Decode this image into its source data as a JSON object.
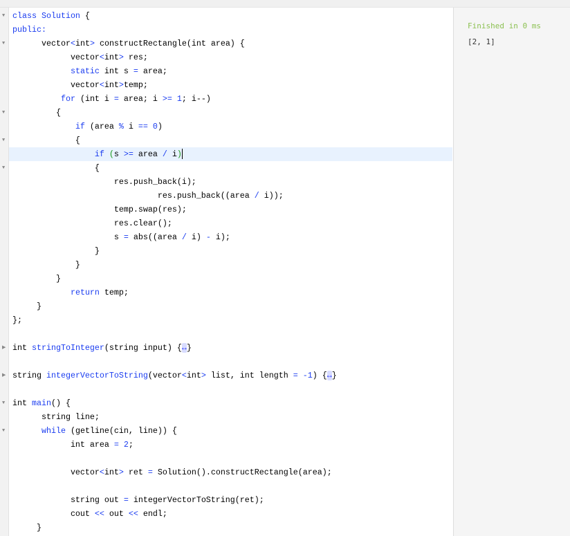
{
  "editor": {
    "lines": [
      {
        "fold": "open",
        "t": [
          [
            "class Solution",
            "k"
          ],
          [
            " {",
            ""
          ]
        ]
      },
      {
        "t": [
          [
            "public:",
            "k"
          ]
        ]
      },
      {
        "fold": "open",
        "t": [
          [
            "      vector",
            ""
          ],
          [
            "<",
            "k"
          ],
          [
            "int",
            ""
          ],
          [
            ">",
            "k"
          ],
          [
            " constructRectangle(int area) {",
            ""
          ]
        ]
      },
      {
        "t": [
          [
            "            vector",
            ""
          ],
          [
            "<",
            "k"
          ],
          [
            "int",
            ""
          ],
          [
            ">",
            "k"
          ],
          [
            " res;",
            ""
          ]
        ]
      },
      {
        "t": [
          [
            "            ",
            ""
          ],
          [
            "static",
            "k"
          ],
          [
            " int s ",
            ""
          ],
          [
            "=",
            "k"
          ],
          [
            " area;",
            ""
          ]
        ]
      },
      {
        "t": [
          [
            "            vector",
            ""
          ],
          [
            "<",
            "k"
          ],
          [
            "int",
            ""
          ],
          [
            ">",
            "k"
          ],
          [
            "temp;",
            ""
          ]
        ]
      },
      {
        "t": [
          [
            "          ",
            ""
          ],
          [
            "for",
            "k"
          ],
          [
            " (int i ",
            ""
          ],
          [
            "=",
            "k"
          ],
          [
            " area; i ",
            ""
          ],
          [
            ">=",
            "k"
          ],
          [
            " ",
            ""
          ],
          [
            "1",
            "k"
          ],
          [
            "; i--)",
            ""
          ]
        ]
      },
      {
        "fold": "open",
        "t": [
          [
            "         {",
            ""
          ]
        ]
      },
      {
        "t": [
          [
            "             ",
            ""
          ],
          [
            "if",
            "k"
          ],
          [
            " (area ",
            ""
          ],
          [
            "%",
            "k"
          ],
          [
            " i ",
            ""
          ],
          [
            "==",
            "k"
          ],
          [
            " ",
            ""
          ],
          [
            "0",
            "k"
          ],
          [
            ")",
            ""
          ]
        ]
      },
      {
        "fold": "open",
        "t": [
          [
            "             {",
            ""
          ]
        ]
      },
      {
        "hl": true,
        "cursor": true,
        "t": [
          [
            "                 ",
            ""
          ],
          [
            "if",
            "k"
          ],
          [
            " ",
            ""
          ],
          [
            "(",
            "g"
          ],
          [
            "s ",
            ""
          ],
          [
            ">=",
            "k"
          ],
          [
            " area ",
            ""
          ],
          [
            "/",
            "k"
          ],
          [
            " i",
            ""
          ],
          [
            ")",
            "g"
          ]
        ]
      },
      {
        "fold": "open",
        "t": [
          [
            "                 {",
            ""
          ]
        ]
      },
      {
        "t": [
          [
            "                     res.push_back(i);",
            ""
          ]
        ]
      },
      {
        "t": [
          [
            "                              res.push_back((area ",
            ""
          ],
          [
            "/",
            "k"
          ],
          [
            " i));",
            ""
          ]
        ]
      },
      {
        "t": [
          [
            "                     temp.swap(res);",
            ""
          ]
        ]
      },
      {
        "t": [
          [
            "                     res.clear();",
            ""
          ]
        ]
      },
      {
        "t": [
          [
            "                     s ",
            ""
          ],
          [
            "=",
            "k"
          ],
          [
            " abs((area ",
            ""
          ],
          [
            "/",
            "k"
          ],
          [
            " i) ",
            ""
          ],
          [
            "-",
            "k"
          ],
          [
            " i);",
            ""
          ]
        ]
      },
      {
        "t": [
          [
            "                 }",
            ""
          ]
        ]
      },
      {
        "t": [
          [
            "             }",
            ""
          ]
        ]
      },
      {
        "t": [
          [
            "         }",
            ""
          ]
        ]
      },
      {
        "t": [
          [
            "            ",
            ""
          ],
          [
            "return",
            "k"
          ],
          [
            " temp;",
            ""
          ]
        ]
      },
      {
        "t": [
          [
            "     }",
            ""
          ]
        ]
      },
      {
        "t": [
          [
            "};",
            ""
          ]
        ]
      },
      {
        "t": []
      },
      {
        "fold": "closed",
        "t": [
          [
            "int ",
            ""
          ],
          [
            "stringToInteger",
            "k"
          ],
          [
            "(string input) {",
            ""
          ],
          [
            "↔",
            "coll"
          ],
          [
            "}",
            ""
          ]
        ]
      },
      {
        "t": []
      },
      {
        "fold": "closed",
        "t": [
          [
            "string ",
            ""
          ],
          [
            "integerVectorToString",
            "k"
          ],
          [
            "(vector",
            ""
          ],
          [
            "<",
            "k"
          ],
          [
            "int",
            ""
          ],
          [
            ">",
            "k"
          ],
          [
            " list, int length ",
            ""
          ],
          [
            "=",
            "k"
          ],
          [
            " ",
            ""
          ],
          [
            "-1",
            "k"
          ],
          [
            ") {",
            ""
          ],
          [
            "↔",
            "coll"
          ],
          [
            "}",
            ""
          ]
        ]
      },
      {
        "t": []
      },
      {
        "fold": "open",
        "t": [
          [
            "int ",
            ""
          ],
          [
            "main",
            "k"
          ],
          [
            "() {",
            ""
          ]
        ]
      },
      {
        "t": [
          [
            "      string line;",
            ""
          ]
        ]
      },
      {
        "fold": "open",
        "t": [
          [
            "      ",
            ""
          ],
          [
            "while",
            "k"
          ],
          [
            " (getline(cin, line)) {",
            ""
          ]
        ]
      },
      {
        "t": [
          [
            "            int area ",
            ""
          ],
          [
            "=",
            "k"
          ],
          [
            " ",
            ""
          ],
          [
            "2",
            "k"
          ],
          [
            ";",
            ""
          ]
        ]
      },
      {
        "t": []
      },
      {
        "t": [
          [
            "            vector",
            ""
          ],
          [
            "<",
            "k"
          ],
          [
            "int",
            ""
          ],
          [
            ">",
            "k"
          ],
          [
            " ret ",
            ""
          ],
          [
            "=",
            "k"
          ],
          [
            " Solution().constructRectangle(area);",
            ""
          ]
        ]
      },
      {
        "t": []
      },
      {
        "t": [
          [
            "            string out ",
            ""
          ],
          [
            "=",
            "k"
          ],
          [
            " integerVectorToString(ret);",
            ""
          ]
        ]
      },
      {
        "t": [
          [
            "            cout ",
            ""
          ],
          [
            "<<",
            "k"
          ],
          [
            " out ",
            ""
          ],
          [
            "<<",
            "k"
          ],
          [
            " endl;",
            ""
          ]
        ]
      },
      {
        "t": [
          [
            "     }",
            ""
          ]
        ]
      }
    ]
  },
  "output": {
    "status": "Finished in 0 ms",
    "result": "[2, 1]"
  },
  "colors": {
    "keyword": "#1a3cf0",
    "status": "#8cc152",
    "highlight": "#e8f2fe"
  }
}
